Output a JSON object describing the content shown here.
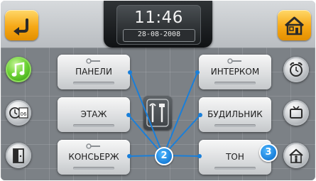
{
  "clock": {
    "time": "11:46",
    "date": "28-08-2008"
  },
  "buttons": {
    "panels": "ПАНЕЛИ",
    "floor": "ЭТАЖ",
    "concierge": "КОНСЬЕРЖ",
    "intercom": "ИНТЕРКОМ",
    "alarm_clock": "БУДИЛЬНИК",
    "tone": "ТОН"
  },
  "icons": {
    "back": "back-arrow-icon",
    "home": "home-icon",
    "music": "music-note-icon",
    "clock_calendar": "clock-calendar-icon",
    "door": "door-icon",
    "alarm": "alarm-clock-icon",
    "tv": "tv-icon",
    "person_home": "person-home-icon",
    "tools": "tools-icon"
  },
  "callouts": {
    "marker_2": "2",
    "marker_3": "3"
  },
  "colors": {
    "accent_orange": "#f6a816",
    "active_green": "#6bd233",
    "callout_blue": "#1a7fd9"
  }
}
